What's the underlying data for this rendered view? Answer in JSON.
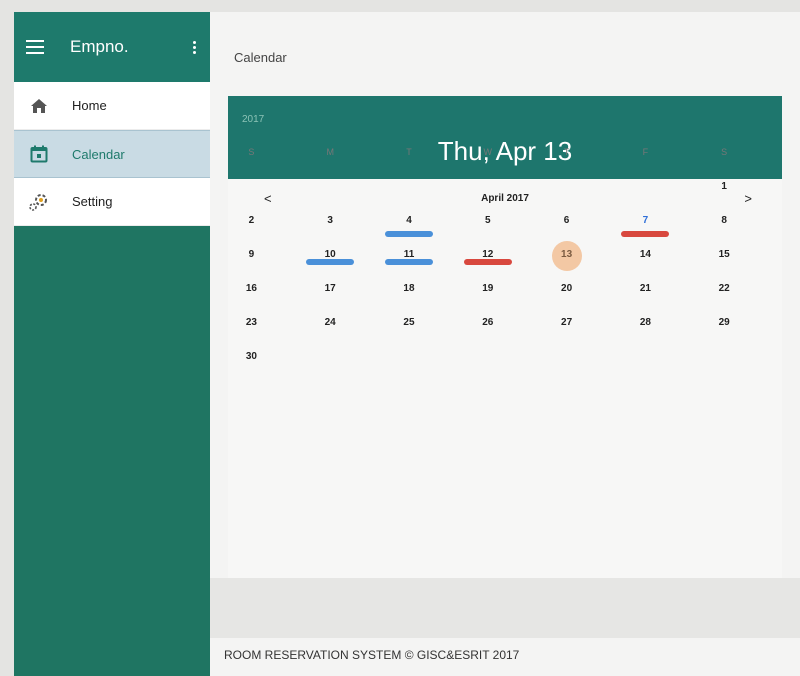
{
  "app": {
    "title": "Empno."
  },
  "sidebar": {
    "items": [
      {
        "label": "Home",
        "icon": "home-icon",
        "active": false
      },
      {
        "label": "Calendar",
        "icon": "calendar-icon",
        "active": true
      },
      {
        "label": "Setting",
        "icon": "gears-icon",
        "active": false
      }
    ]
  },
  "page": {
    "title": "Calendar"
  },
  "calendar": {
    "year": "2017",
    "selected_date": "Thu, Apr 13",
    "month_label": "April 2017",
    "prev": "<",
    "next": ">",
    "weekdays": [
      "S",
      "M",
      "T",
      "W",
      "T",
      "F",
      "S"
    ],
    "weeks": [
      [
        "",
        "",
        "",
        "",
        "",
        "",
        "1"
      ],
      [
        "2",
        "3",
        "4",
        "5",
        "6",
        "7",
        "8"
      ],
      [
        "9",
        "10",
        "11",
        "12",
        "13",
        "14",
        "15"
      ],
      [
        "16",
        "17",
        "18",
        "19",
        "20",
        "21",
        "22"
      ],
      [
        "23",
        "24",
        "25",
        "26",
        "27",
        "28",
        "29"
      ],
      [
        "30",
        "",
        "",
        "",
        "",
        "",
        ""
      ]
    ],
    "today": "13",
    "highlight_blue_text": [
      "7"
    ],
    "event_bars": [
      {
        "day": "4",
        "color": "blue"
      },
      {
        "day": "7",
        "color": "red"
      },
      {
        "day": "10",
        "color": "blue"
      },
      {
        "day": "11",
        "color": "blue"
      },
      {
        "day": "12",
        "color": "red"
      }
    ]
  },
  "colors": {
    "brand": "#1e7a6c",
    "sidebar_bg": "#1f7562",
    "today_circle": "#f3c8a4",
    "event_blue": "#4a90d9",
    "event_red": "#d8483e"
  },
  "footer": {
    "text": "ROOM RESERVATION SYSTEM © GISC&ESRIT 2017"
  }
}
